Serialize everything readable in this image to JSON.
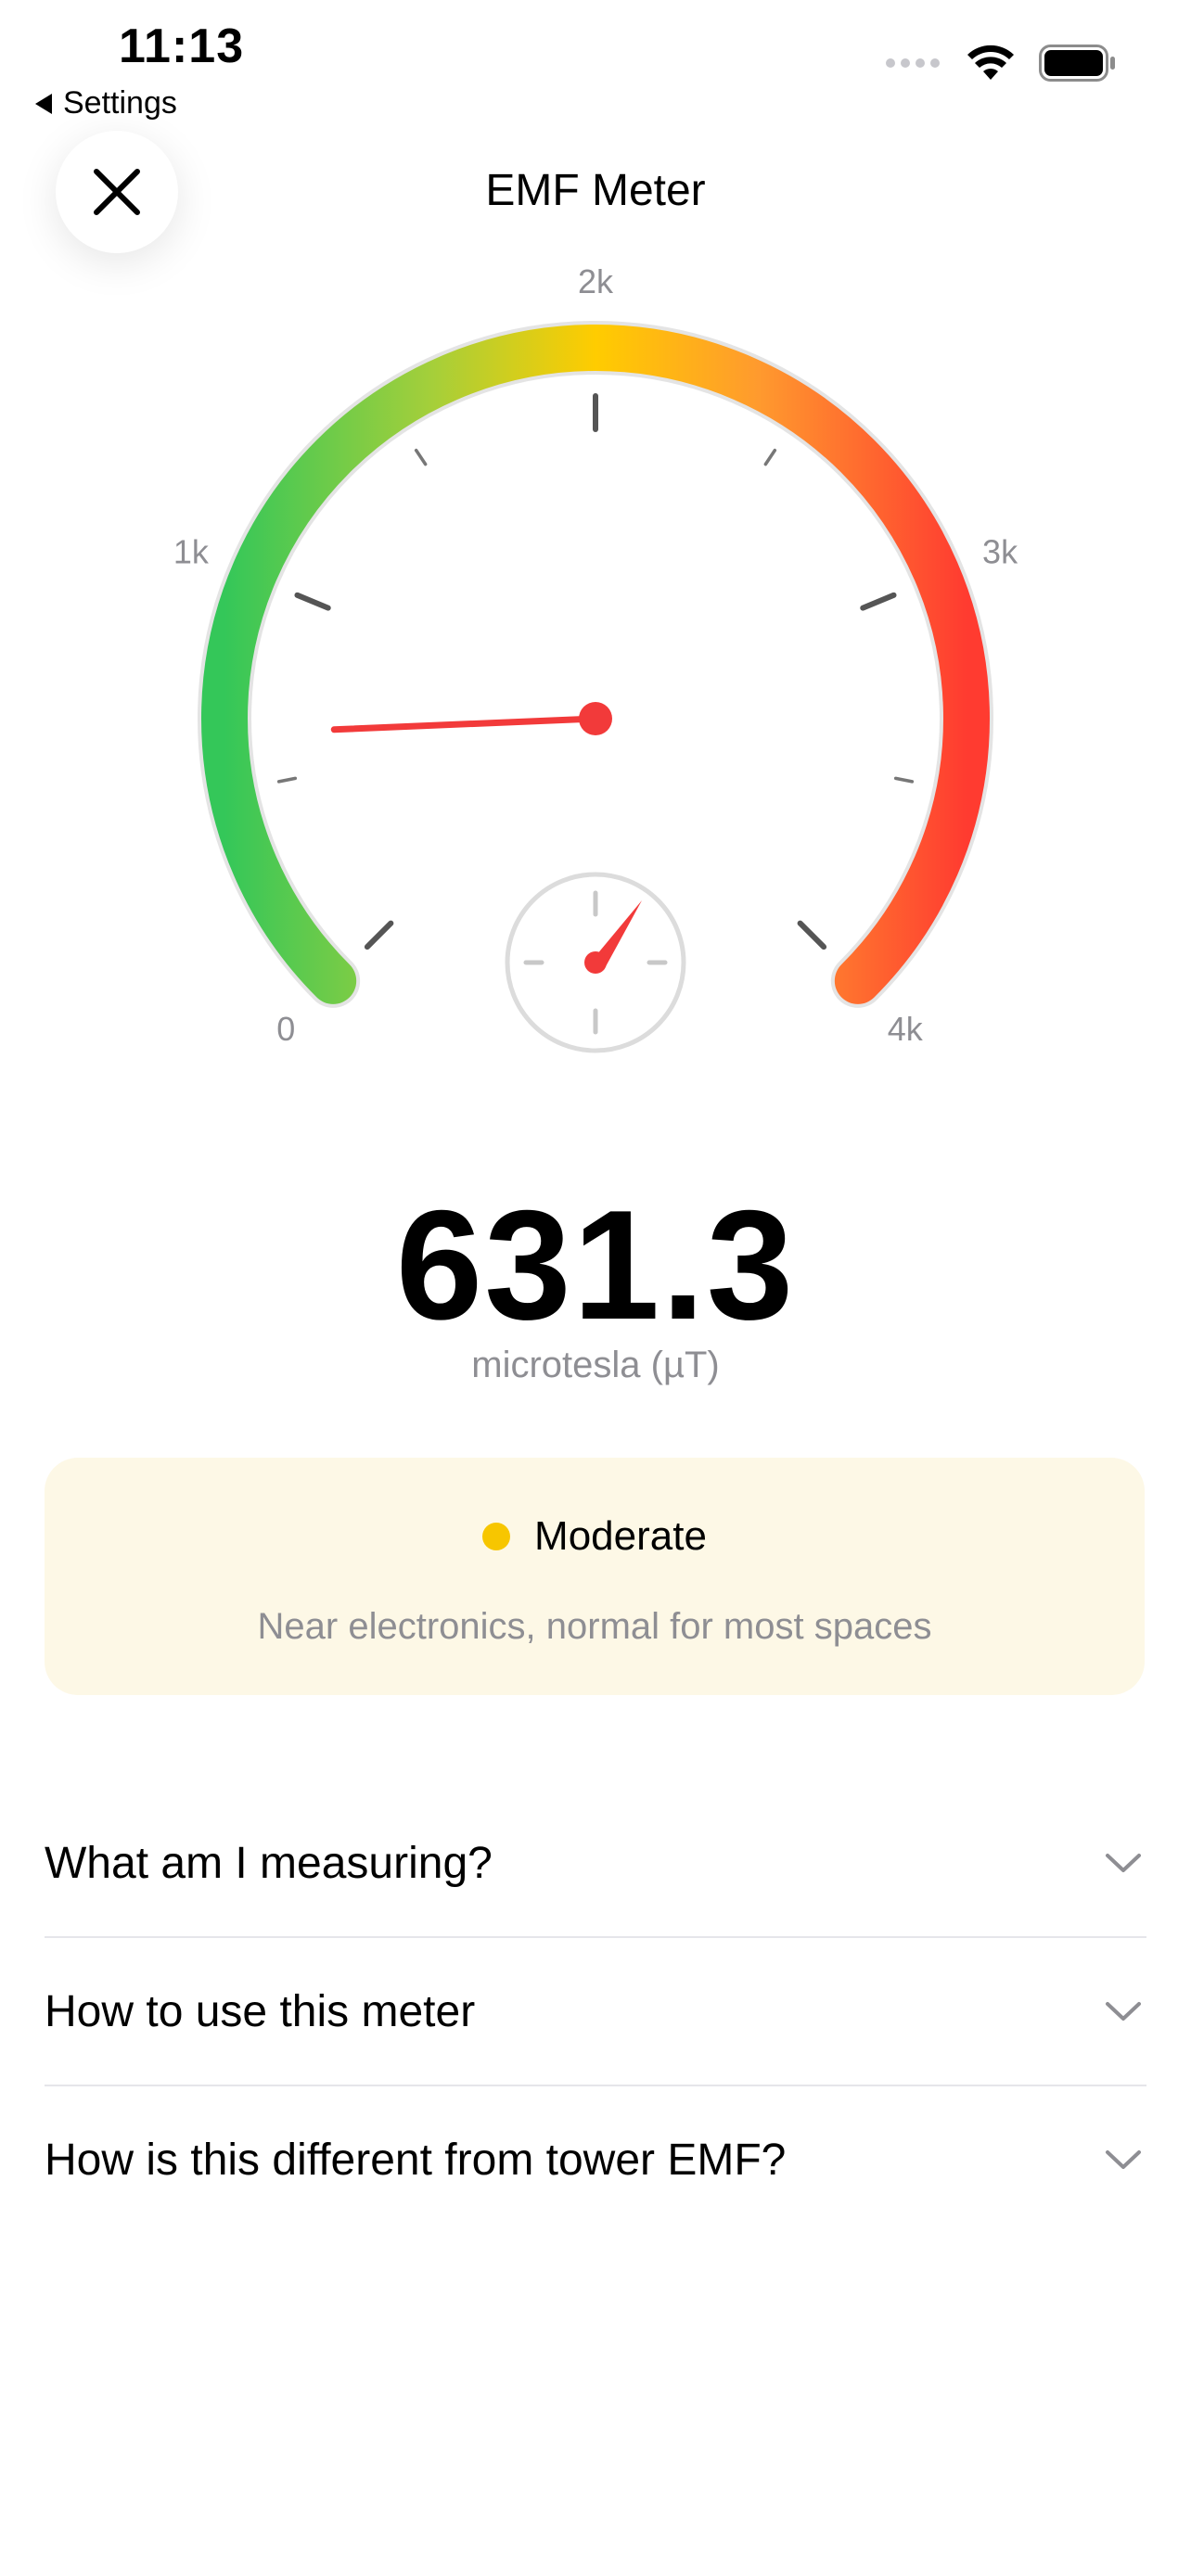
{
  "status_bar": {
    "time": "11:13",
    "back_app": "Settings",
    "icons": [
      "signal-dots-icon",
      "wifi-icon",
      "battery-icon"
    ]
  },
  "nav": {
    "title": "EMF Meter",
    "close_icon": "close-icon"
  },
  "gauge": {
    "scale_labels": [
      "0",
      "1k",
      "2k",
      "3k",
      "4k"
    ],
    "min": 0,
    "max": 4000,
    "value": 631.3,
    "colors": {
      "low": "#34c759",
      "mid_low": "#a5cf3a",
      "mid": "#ffcc00",
      "mid_high": "#ff9a2e",
      "high": "#ff3b30",
      "needle": "#f23a3a"
    },
    "center_icon": "speedometer-icon"
  },
  "reading": {
    "value": "631.3",
    "unit": "microtesla (µT)"
  },
  "status_card": {
    "level": "Moderate",
    "level_color": "#f7c600",
    "description": "Near electronics, normal for most spaces"
  },
  "faq": [
    {
      "label": "What am I measuring?"
    },
    {
      "label": "How to use this meter"
    },
    {
      "label": "How is this different from tower EMF?"
    }
  ]
}
